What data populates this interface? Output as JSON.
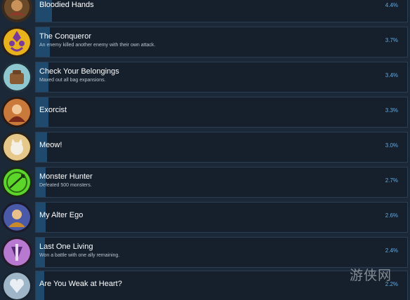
{
  "achievements": [
    {
      "title": "Bloodied Hands",
      "description": "",
      "percent": "4.4%",
      "unlock_fraction": 0.044,
      "icon": "bloodied-hands-badge-icon"
    },
    {
      "title": "The Conqueror",
      "description": "An enemy killed another enemy with their own attack.",
      "percent": "3.7%",
      "unlock_fraction": 0.037,
      "icon": "conqueror-badge-icon"
    },
    {
      "title": "Check Your Belongings",
      "description": "Maxed out all bag expansions.",
      "percent": "3.4%",
      "unlock_fraction": 0.034,
      "icon": "belongings-badge-icon"
    },
    {
      "title": "Exorcist",
      "description": "",
      "percent": "3.3%",
      "unlock_fraction": 0.033,
      "icon": "exorcist-badge-icon"
    },
    {
      "title": "Meow!",
      "description": "",
      "percent": "3.0%",
      "unlock_fraction": 0.03,
      "icon": "meow-badge-icon"
    },
    {
      "title": "Monster Hunter",
      "description": "Defeated 500 monsters.",
      "percent": "2.7%",
      "unlock_fraction": 0.027,
      "icon": "monster-hunter-badge-icon"
    },
    {
      "title": "My Alter Ego",
      "description": "",
      "percent": "2.6%",
      "unlock_fraction": 0.026,
      "icon": "alter-ego-badge-icon"
    },
    {
      "title": "Last One Living",
      "description": "Won a battle with one ally remaining.",
      "percent": "2.4%",
      "unlock_fraction": 0.024,
      "icon": "last-one-living-badge-icon"
    },
    {
      "title": "Are You Weak at Heart?",
      "description": "",
      "percent": "2.2%",
      "unlock_fraction": 0.022,
      "icon": "weak-at-heart-badge-icon"
    }
  ],
  "watermark": "游侠网",
  "colors": {
    "background": "#1b2837",
    "panel": "#16202d",
    "progress_fill": "#1f4a6e",
    "percent_text": "#69a8d8"
  }
}
